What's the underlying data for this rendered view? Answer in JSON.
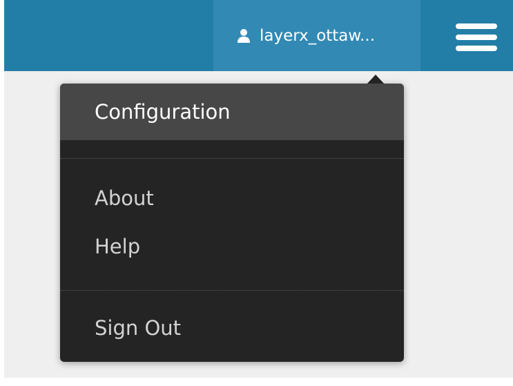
{
  "header": {
    "user_name": "layerx_ottaw...",
    "user_icon": "user-icon",
    "menu_icon": "hamburger-menu-icon"
  },
  "dropdown": {
    "items": [
      {
        "label": "Configuration",
        "active": true
      },
      {
        "label": "About"
      },
      {
        "label": "Help"
      },
      {
        "label": "Sign Out"
      }
    ]
  },
  "colors": {
    "header_bg": "#237ea7",
    "user_menu_bg": "#3289b4",
    "dropdown_bg": "#242424",
    "active_item_bg": "#474747",
    "page_bg": "#efefef"
  }
}
